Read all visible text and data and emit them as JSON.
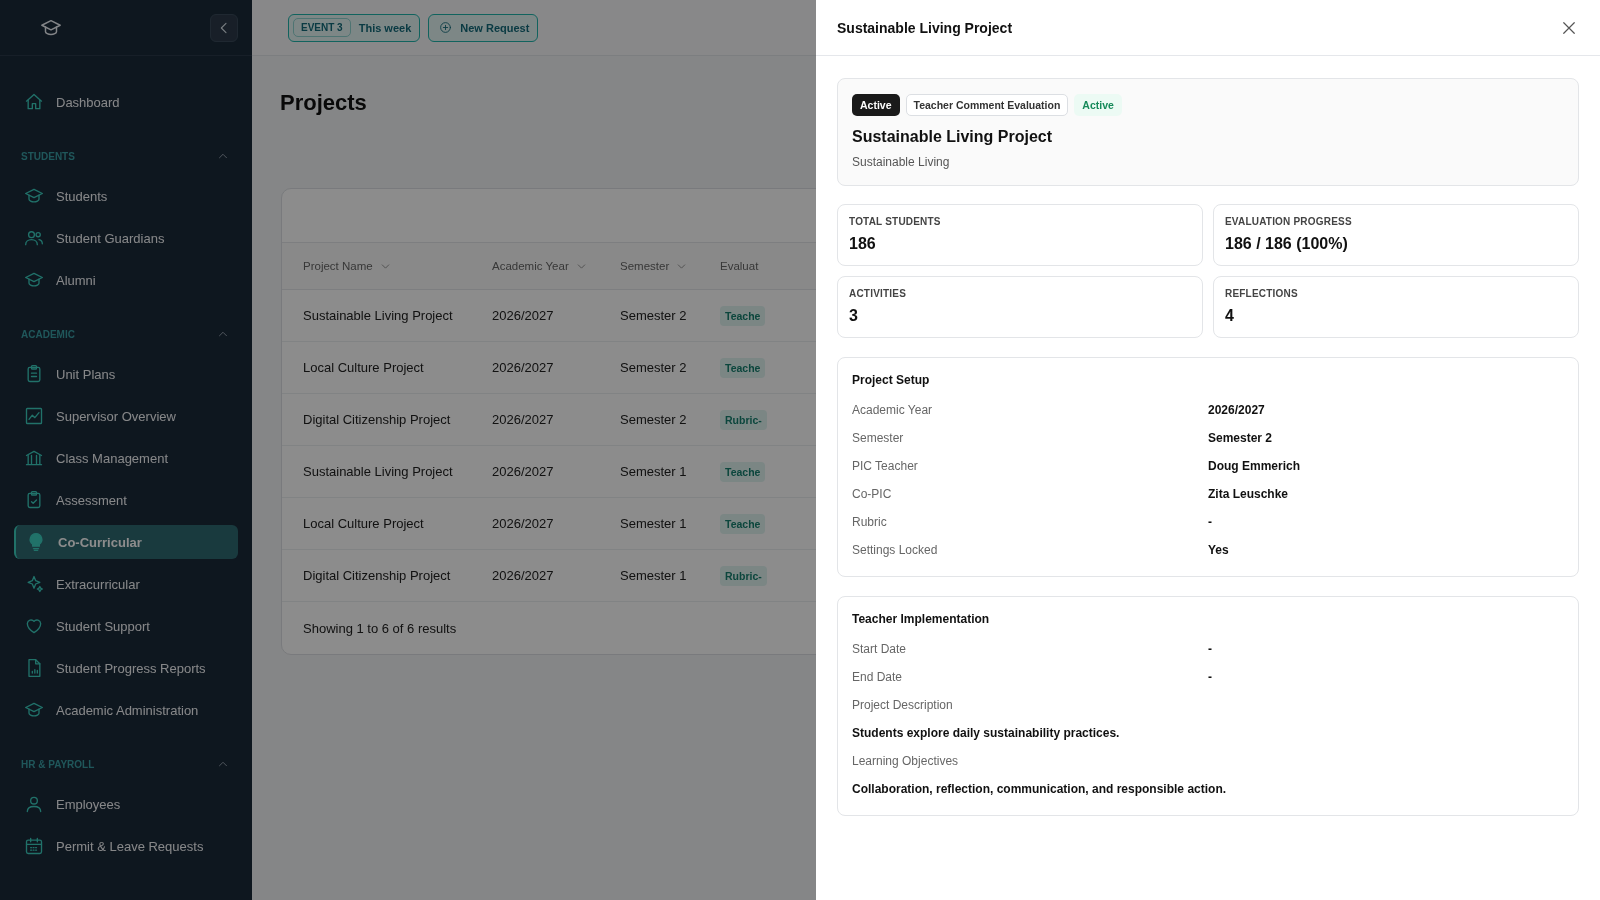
{
  "sidebar": {
    "items": [
      {
        "label": "Dashboard",
        "selected": false
      }
    ],
    "sections": [
      {
        "title": "STUDENTS",
        "expanded": true,
        "items": [
          {
            "label": "Students",
            "selected": false
          },
          {
            "label": "Student Guardians",
            "selected": false
          },
          {
            "label": "Alumni",
            "selected": false
          }
        ]
      },
      {
        "title": "ACADEMIC",
        "expanded": true,
        "items": [
          {
            "label": "Unit Plans",
            "selected": false
          },
          {
            "label": "Supervisor Overview",
            "selected": false
          },
          {
            "label": "Class Management",
            "selected": false
          },
          {
            "label": "Assessment",
            "selected": false
          },
          {
            "label": "Co-Curricular",
            "selected": true
          },
          {
            "label": "Extracurricular",
            "selected": false
          },
          {
            "label": "Student Support",
            "selected": false
          },
          {
            "label": "Student Progress Reports",
            "selected": false
          },
          {
            "label": "Academic Administration",
            "selected": false
          }
        ]
      },
      {
        "title": "HR & PAYROLL",
        "expanded": true,
        "items": [
          {
            "label": "Employees",
            "selected": false
          },
          {
            "label": "Permit & Leave Requests",
            "selected": false
          }
        ]
      }
    ]
  },
  "topbar": {
    "event_badge": "EVENT 3",
    "event_text": "This week",
    "new_request": "New Request"
  },
  "page": {
    "title": "Projects",
    "table": {
      "columns": [
        "Project Name",
        "Academic Year",
        "Semester",
        "Evaluat"
      ],
      "rows": [
        {
          "cells": [
            "Sustainable Living Project",
            "2026/2027",
            "Semester 2"
          ],
          "tag": "Teache"
        },
        {
          "cells": [
            "Local Culture Project",
            "2026/2027",
            "Semester 2"
          ],
          "tag": "Teache"
        },
        {
          "cells": [
            "Digital Citizenship Project",
            "2026/2027",
            "Semester 2"
          ],
          "tag": "Rubric-"
        },
        {
          "cells": [
            "Sustainable Living Project",
            "2026/2027",
            "Semester 1"
          ],
          "tag": "Teache"
        },
        {
          "cells": [
            "Local Culture Project",
            "2026/2027",
            "Semester 1"
          ],
          "tag": "Teache"
        },
        {
          "cells": [
            "Digital Citizenship Project",
            "2026/2027",
            "Semester 1"
          ],
          "tag": "Rubric-"
        }
      ],
      "footer": "Showing 1 to 6 of 6 results"
    }
  },
  "drawer": {
    "title": "Sustainable Living Project",
    "badges": [
      {
        "text": "Active",
        "kind": "solid"
      },
      {
        "text": "Teacher Comment Evaluation",
        "kind": "outline"
      },
      {
        "text": "Active",
        "kind": "soft"
      }
    ],
    "project_title": "Sustainable Living Project",
    "subtitle": "Sustainable Living",
    "stats": [
      {
        "label": "TOTAL STUDENTS",
        "value": "186"
      },
      {
        "label": "EVALUATION PROGRESS",
        "value": "186 / 186 (100%)"
      },
      {
        "label": "ACTIVITIES",
        "value": "3"
      },
      {
        "label": "REFLECTIONS",
        "value": "4"
      }
    ],
    "sections": [
      {
        "title": "Project Setup",
        "fields": [
          {
            "kind": "row",
            "label": "Academic Year",
            "value": "2026/2027"
          },
          {
            "kind": "row",
            "label": "Semester",
            "value": "Semester 2"
          },
          {
            "kind": "row",
            "label": "PIC Teacher",
            "value": "Doug Emmerich"
          },
          {
            "kind": "row",
            "label": "Co-PIC",
            "value": "Zita Leuschke"
          },
          {
            "kind": "row",
            "label": "Rubric",
            "value": "-"
          },
          {
            "kind": "row",
            "label": "Settings Locked",
            "value": "Yes"
          }
        ]
      },
      {
        "title": "Teacher Implementation",
        "fields": [
          {
            "kind": "row",
            "label": "Start Date",
            "value": "-"
          },
          {
            "kind": "row",
            "label": "End Date",
            "value": "-"
          },
          {
            "kind": "label",
            "text": "Project Description"
          },
          {
            "kind": "paragraph",
            "text": "Students explore daily sustainability practices."
          },
          {
            "kind": "label",
            "text": "Learning Objectives"
          },
          {
            "kind": "paragraph",
            "text": "Collaboration, reflection, communication, and responsible action."
          }
        ]
      }
    ]
  }
}
